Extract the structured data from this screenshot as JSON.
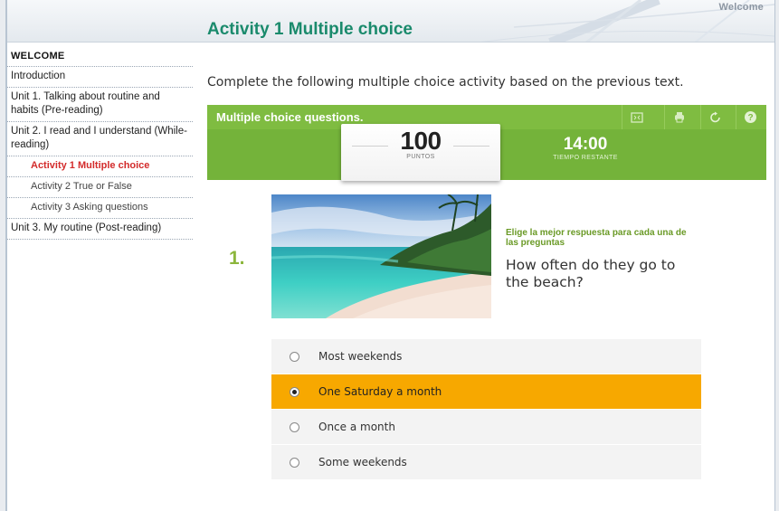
{
  "header": {
    "corner_label": "Welcome",
    "page_title": "Activity 1 Multiple choice"
  },
  "sidebar": {
    "heading": "WELCOME",
    "items": [
      {
        "label": "Introduction",
        "level": 0
      },
      {
        "label": "Unit 1. Talking about routine and habits (Pre-reading)",
        "level": 0
      },
      {
        "label": "Unit 2. I read and I understand (While-reading)",
        "level": 0
      },
      {
        "label": "Activity 1 Multiple choice",
        "level": 1,
        "active": true
      },
      {
        "label": "Activity 2 True or False",
        "level": 1
      },
      {
        "label": "Activity 3 Asking questions",
        "level": 1
      },
      {
        "label": "Unit 3. My routine (Post-reading)",
        "level": 0
      }
    ]
  },
  "content": {
    "instructions": "Complete the following multiple choice activity based on the previous text."
  },
  "quiz": {
    "title": "Multiple choice questions.",
    "toolbar": [
      "fullscreen-icon",
      "print-icon",
      "reload-icon",
      "help-icon"
    ],
    "score_value": "100",
    "score_label": "PUNTOS",
    "timer_value": "14:00",
    "timer_label": "TIEMPO RESTANTE",
    "accent_color": "#7fbc41",
    "selected_color": "#f7a800"
  },
  "question": {
    "number": "1.",
    "hint": "Elige la mejor respuesta para cada una de las preguntas",
    "text": "How often do they go to the beach?",
    "image": "beach-photo",
    "options": [
      {
        "label": "Most weekends",
        "selected": false
      },
      {
        "label": "One Saturday a month",
        "selected": true
      },
      {
        "label": "Once a month",
        "selected": false
      },
      {
        "label": "Some weekends",
        "selected": false
      }
    ]
  }
}
